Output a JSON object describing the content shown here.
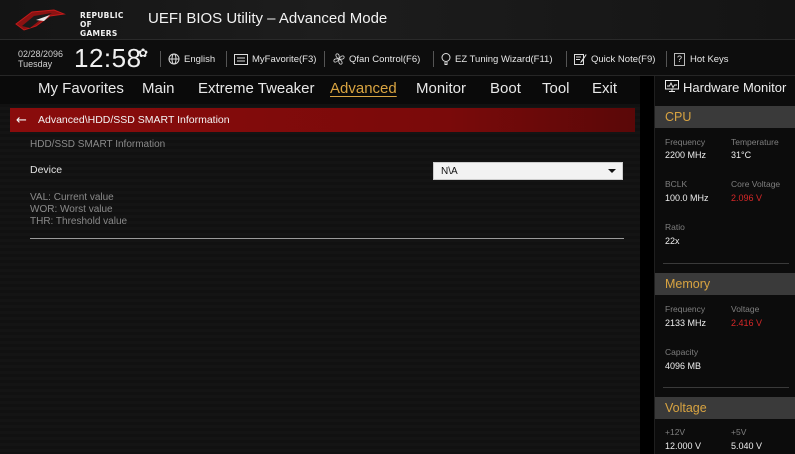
{
  "app": {
    "brand_line1": "REPUBLIC OF",
    "brand_line2": "GAMERS",
    "title": "UEFI BIOS Utility – Advanced Mode"
  },
  "toolbar": {
    "date": "02/28/2096",
    "day": "Tuesday",
    "time": "12:58",
    "language": "English",
    "myfavorite": "MyFavorite(F3)",
    "qfan": "Qfan Control(F6)",
    "ez_tuning": "EZ Tuning Wizard(F11)",
    "quick_note": "Quick Note(F9)",
    "hotkeys_key": "?",
    "hotkeys": "Hot Keys"
  },
  "menu": {
    "items": [
      "My Favorites",
      "Main",
      "Extreme Tweaker",
      "Advanced",
      "Monitor",
      "Boot",
      "Tool",
      "Exit"
    ],
    "active": "Advanced"
  },
  "main": {
    "breadcrumb": "Advanced\\HDD/SSD SMART Information",
    "section_title": "HDD/SSD SMART Information",
    "device_label": "Device",
    "device_value": "N\\A",
    "legend": [
      "VAL:  Current value",
      "WOR: Worst value",
      "THR:  Threshold value"
    ]
  },
  "hardware_monitor": {
    "title": "Hardware Monitor",
    "cpu": {
      "title": "CPU",
      "frequency_label": "Frequency",
      "frequency": "2200 MHz",
      "temperature_label": "Temperature",
      "temperature": "31°C",
      "bclk_label": "BCLK",
      "bclk": "100.0 MHz",
      "core_voltage_label": "Core Voltage",
      "core_voltage": "2.096 V",
      "ratio_label": "Ratio",
      "ratio": "22x"
    },
    "memory": {
      "title": "Memory",
      "frequency_label": "Frequency",
      "frequency": "2133 MHz",
      "voltage_label": "Voltage",
      "voltage": "2.416 V",
      "capacity_label": "Capacity",
      "capacity": "4096 MB"
    },
    "voltage": {
      "title": "Voltage",
      "v12_label": "+12V",
      "v12": "12.000 V",
      "v5_label": "+5V",
      "v5": "5.040 V"
    }
  },
  "colors": {
    "accent": "#d9a441",
    "breadcrumb_bg": "#8a0c0c",
    "warning_value": "#d62828"
  }
}
